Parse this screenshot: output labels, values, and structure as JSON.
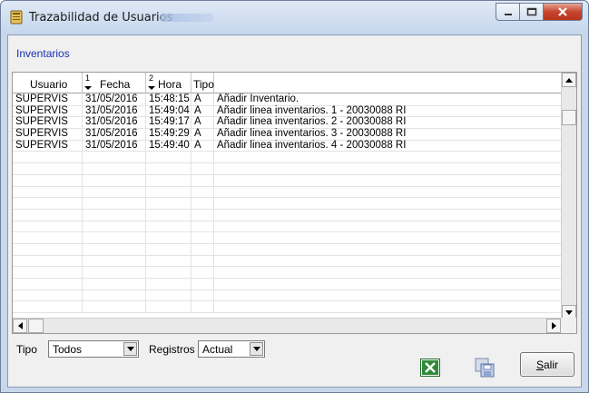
{
  "window": {
    "title": "Trazabilidad de Usuarios"
  },
  "section_label": "Inventarios",
  "grid": {
    "columns": [
      {
        "label": "Usuario",
        "sort_index": ""
      },
      {
        "label": "Fecha",
        "sort_index": "1"
      },
      {
        "label": "Hora",
        "sort_index": "2"
      },
      {
        "label": "Tipo",
        "sort_index": ""
      },
      {
        "label": "",
        "sort_index": ""
      }
    ],
    "rows": [
      [
        "SUPERVIS",
        "31/05/2016",
        "15:48:15",
        "A",
        "Añadir Inventario."
      ],
      [
        "SUPERVIS",
        "31/05/2016",
        "15:49:04",
        "A",
        "Añadir linea inventarios.  1 - 20030088 RI"
      ],
      [
        "SUPERVIS",
        "31/05/2016",
        "15:49:17",
        "A",
        "Añadir linea inventarios.  2 - 20030088 RI"
      ],
      [
        "SUPERVIS",
        "31/05/2016",
        "15:49:29",
        "A",
        "Añadir linea inventarios.  3 - 20030088 RI"
      ],
      [
        "SUPERVIS",
        "31/05/2016",
        "15:49:40",
        "A",
        "Añadir linea inventarios.  4 - 20030088 RI"
      ]
    ],
    "empty_rows": 14
  },
  "filters": {
    "tipo_label": "Tipo",
    "tipo_value": "Todos",
    "registros_label": "Registros",
    "registros_value": "Actual"
  },
  "buttons": {
    "excel_icon": "excel-export-icon",
    "save_icon": "save-disk-icon",
    "salir_first": "S",
    "salir_rest": "alir"
  },
  "colors": {
    "section_label": "#1a2fb0",
    "close_button": "#c7462f"
  }
}
